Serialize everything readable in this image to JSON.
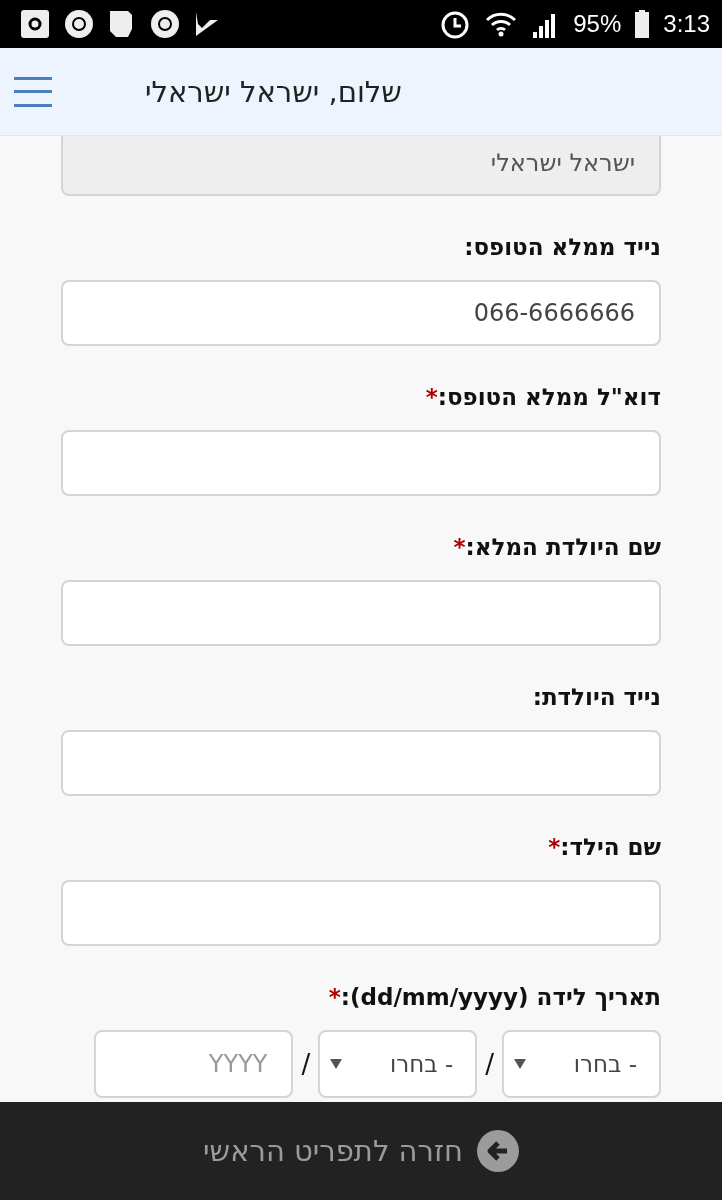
{
  "status_bar": {
    "battery": "95%",
    "time": "3:13"
  },
  "header": {
    "title": "שלום, ישראל ישראלי"
  },
  "fields": [
    {
      "kind": "text",
      "value": "ישראל ישראלי",
      "disabled": true
    },
    {
      "kind": "text",
      "label": "נייד ממלא הטופס:",
      "value": "066-6666666",
      "disabled": false
    },
    {
      "kind": "text",
      "label": "דוא\"ל ממלא הטופס:",
      "required_mark": "*",
      "disabled": false
    },
    {
      "kind": "text",
      "label": "שם היולדת המלא:",
      "required_mark": "*",
      "disabled": false
    },
    {
      "kind": "text",
      "label": "נייד היולדת:",
      "disabled": false
    },
    {
      "kind": "text",
      "label": "שם הילד:",
      "required_mark": "*",
      "disabled": false
    },
    {
      "kind": "date",
      "label": "תאריך לידה (dd/mm/yyyy):",
      "required_mark": "*",
      "parts": [
        {
          "kind": "select",
          "value": "- בחרו"
        },
        {
          "kind": "separator",
          "text": "/"
        },
        {
          "kind": "select",
          "value": "- בחרו"
        },
        {
          "kind": "separator",
          "text": "/"
        },
        {
          "kind": "input",
          "placeholder": "YYYY"
        }
      ]
    }
  ],
  "footer": {
    "label": "חזרה לתפריט הראשי"
  }
}
